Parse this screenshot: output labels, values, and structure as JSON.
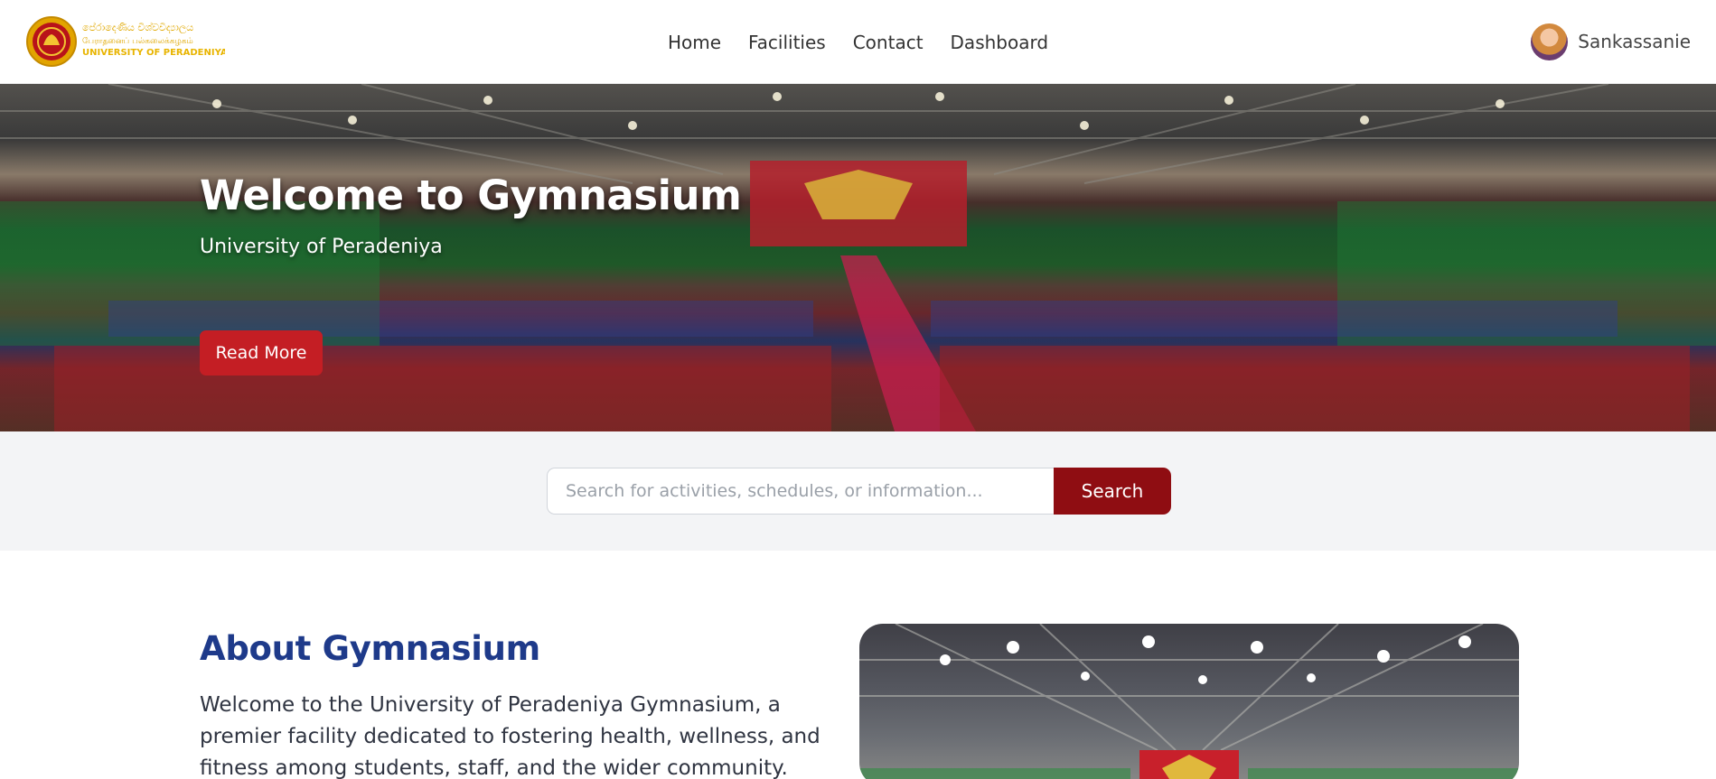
{
  "header": {
    "logo": {
      "line1": "පේරාදෙණිය විශ්වවිද්‍යාලය",
      "line2": "பேராதனைப் பல்கலைக்கழகம்",
      "line3": "UNIVERSITY OF PERADENIYA"
    },
    "nav": [
      {
        "label": "Home"
      },
      {
        "label": "Facilities"
      },
      {
        "label": "Contact"
      },
      {
        "label": "Dashboard"
      }
    ],
    "user": {
      "name": "Sankassanie"
    }
  },
  "hero": {
    "title": "Welcome to Gymnasium",
    "subtitle": "University of Peradeniya",
    "button_label": "Read More"
  },
  "search": {
    "placeholder": "Search for activities, schedules, or information...",
    "button_label": "Search"
  },
  "about": {
    "title": "About Gymnasium",
    "text": "Welcome to the University of Peradeniya Gymnasium, a premier facility dedicated to fostering health, wellness, and fitness among students, staff, and the wider community. Our"
  },
  "colors": {
    "brand_red": "#c41e24",
    "search_button": "#8f0d12",
    "about_title": "#1e3a8a",
    "logo_gold": "#f0c419"
  },
  "icons": [
    "university-logo-icon",
    "user-avatar"
  ]
}
